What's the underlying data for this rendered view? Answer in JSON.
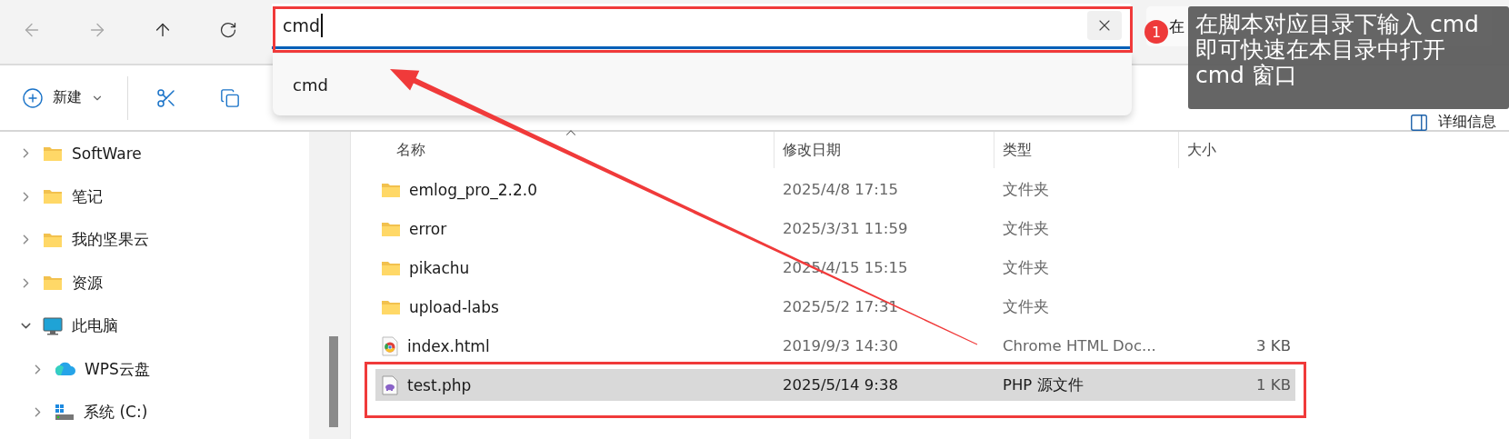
{
  "nav_buttons": [
    {
      "kind": "back",
      "disabled": true
    },
    {
      "kind": "forward",
      "disabled": true
    },
    {
      "kind": "up",
      "disabled": false
    },
    {
      "kind": "refresh",
      "disabled": false
    }
  ],
  "address_bar": {
    "value": "cmd",
    "suggestions": [
      "cmd"
    ]
  },
  "search": {
    "placeholder": "在"
  },
  "annotation": {
    "badge": "1",
    "tooltip": "在脚本对应目录下输入 cmd 即可快速在本目录中打开 cmd 窗口"
  },
  "toolbar": {
    "new_button": "新建",
    "actions": [
      {
        "kind": "cut"
      },
      {
        "kind": "copy"
      }
    ],
    "details_button": "详细信息"
  },
  "sidebar": {
    "items": [
      {
        "label": "SoftWare",
        "kind": "folder",
        "expanded": false
      },
      {
        "label": "笔记",
        "kind": "folder",
        "expanded": false
      },
      {
        "label": "我的坚果云",
        "kind": "folder",
        "expanded": false
      },
      {
        "label": "资源",
        "kind": "folder",
        "expanded": false
      },
      {
        "label": "此电脑",
        "kind": "pc",
        "expanded": true,
        "children": [
          {
            "label": "WPS云盘",
            "kind": "cloud",
            "expanded": false
          },
          {
            "label": "系统 (C:)",
            "kind": "drive",
            "expanded": false
          }
        ]
      }
    ]
  },
  "table": {
    "columns": [
      {
        "label": "名称",
        "sorted": true
      },
      {
        "label": "修改日期",
        "sorted": false
      },
      {
        "label": "类型",
        "sorted": false
      },
      {
        "label": "大小",
        "sorted": false
      }
    ],
    "rows": [
      {
        "name": "emlog_pro_2.2.0",
        "kind": "folder",
        "date": "2025/4/8 17:15",
        "type": "文件夹",
        "selected": false
      },
      {
        "name": "error",
        "kind": "folder",
        "date": "2025/3/31 11:59",
        "type": "文件夹",
        "selected": false
      },
      {
        "name": "pikachu",
        "kind": "folder",
        "date": "2025/4/15 15:15",
        "type": "文件夹",
        "selected": false
      },
      {
        "name": "upload-labs",
        "kind": "folder",
        "date": "2025/5/2 17:31",
        "type": "文件夹",
        "selected": false
      },
      {
        "name": "index.html",
        "kind": "html",
        "date": "2019/9/3 14:30",
        "type": "Chrome HTML Doc...",
        "size": "3 KB",
        "selected": false
      },
      {
        "name": "test.php",
        "kind": "php",
        "date": "2025/5/14 9:38",
        "type": "PHP 源文件",
        "size": "1 KB",
        "selected": true
      }
    ]
  }
}
